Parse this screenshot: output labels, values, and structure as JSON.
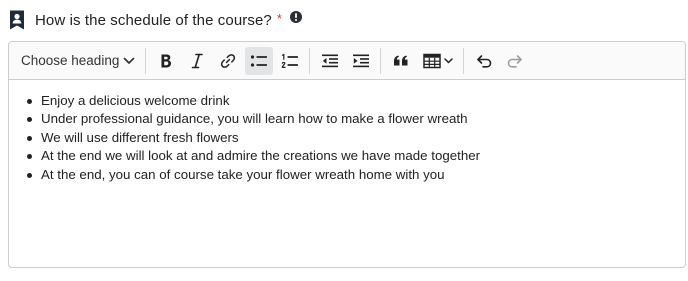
{
  "question": {
    "text": "How is the schedule of the course?",
    "required_mark": "*",
    "icon": "bookmark-person-icon",
    "info_icon": "info-circle-icon"
  },
  "toolbar": {
    "heading_select": "Choose heading",
    "buttons": [
      {
        "name": "bold",
        "icon": "bold-icon"
      },
      {
        "name": "italic",
        "icon": "italic-icon"
      },
      {
        "name": "link",
        "icon": "link-icon"
      },
      {
        "name": "bulleted-list",
        "icon": "bulleted-list-icon",
        "active": true
      },
      {
        "name": "numbered-list",
        "icon": "numbered-list-icon"
      },
      {
        "name": "outdent",
        "icon": "outdent-icon"
      },
      {
        "name": "indent",
        "icon": "indent-icon"
      },
      {
        "name": "block-quote",
        "icon": "quote-icon"
      },
      {
        "name": "insert-table",
        "icon": "table-icon"
      },
      {
        "name": "undo",
        "icon": "undo-icon"
      },
      {
        "name": "redo",
        "icon": "redo-icon"
      }
    ]
  },
  "content": {
    "items": [
      "Enjoy a delicious welcome drink",
      "Under professional guidance, you will learn how to make a flower wreath",
      "We will use different fresh flowers",
      "At the end we will look at and admire the creations we have made together",
      "At the end, you can of course take your flower wreath home with you"
    ]
  },
  "colors": {
    "required": "#e0392b",
    "border": "#c9cdd2",
    "toolbar_bg": "#fafafa",
    "active_button_bg": "#e3e4e6"
  }
}
